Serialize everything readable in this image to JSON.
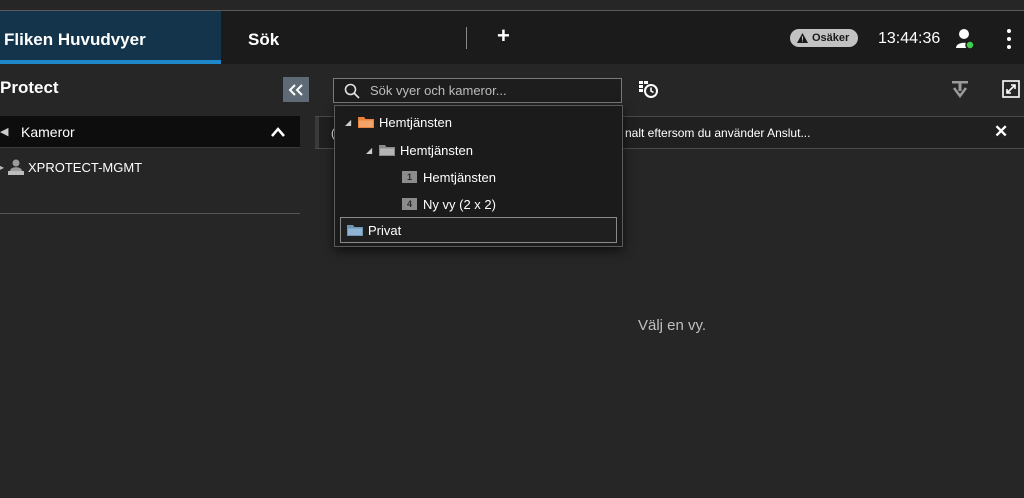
{
  "tabs": {
    "main": "Fliken Huvudvyer",
    "search": "Sök",
    "add": "+"
  },
  "status": {
    "badge": "Osäker",
    "time": "13:44:36"
  },
  "sidebar": {
    "title": "Protect",
    "section": "Kameror",
    "server": "XPROTECT-MGMT"
  },
  "search": {
    "placeholder": "Sök vyer och kameror..."
  },
  "notification": {
    "lead": "(",
    "text": "nalt eftersom du använder Anslut..."
  },
  "main": {
    "empty_message": "Välj en vy."
  },
  "dropdown": {
    "items": [
      {
        "label": "Hemtjänsten",
        "level": 0
      },
      {
        "label": "Hemtjänsten",
        "level": 1
      },
      {
        "label": "Hemtjänsten",
        "level": 2,
        "badge": "1"
      },
      {
        "label": "Ny vy (2 x 2)",
        "level": 2,
        "badge": "4"
      },
      {
        "label": "Privat",
        "level": 0
      }
    ]
  },
  "colors": {
    "accent": "#1e87c9",
    "tab_active_bg": "#13344a",
    "folder_orange": "#e8823a",
    "folder_blue": "#8fb4d4",
    "status_green": "#3ecf4a"
  }
}
